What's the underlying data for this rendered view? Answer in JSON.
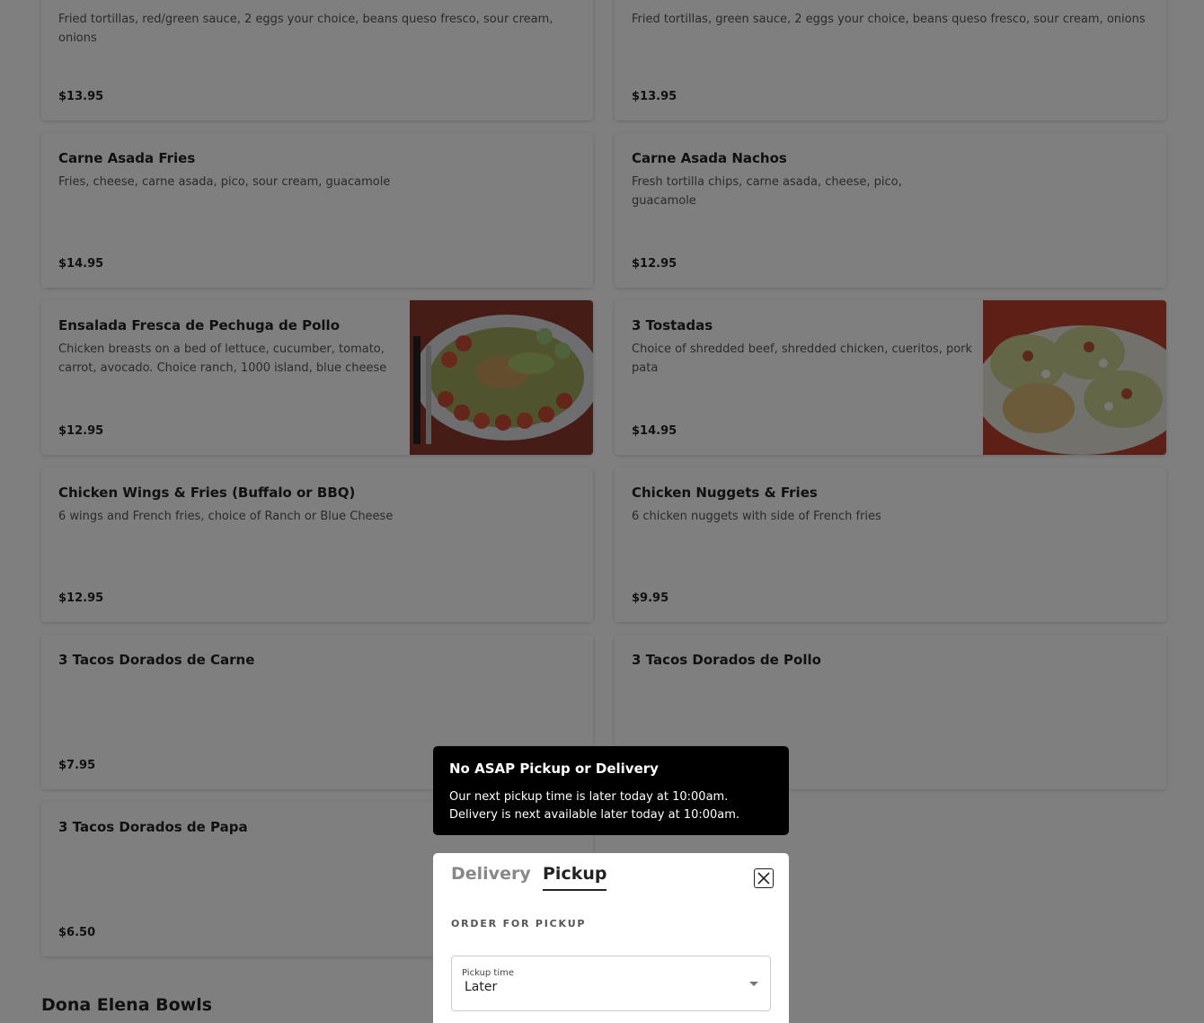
{
  "menu_items": [
    {
      "title": "",
      "description": "Fried tortillas, red/green sauce, 2 eggs your choice, beans queso fresco, sour cream, onions",
      "price": "$13.95"
    },
    {
      "title": "",
      "description": "Fried tortillas, green sauce, 2 eggs your choice, beans queso fresco, sour cream, onions",
      "price": "$13.95"
    },
    {
      "title": "Carne Asada Fries",
      "description": "Fries, cheese, carne asada, pico, sour cream, guacamole",
      "price": "$14.95"
    },
    {
      "title": "Carne Asada Nachos",
      "description": "Fresh tortilla chips, carne asada, cheese, pico, guacamole",
      "price": "$12.95"
    },
    {
      "title": "Ensalada Fresca de Pechuga de Pollo",
      "description": "Chicken breasts on a bed of lettuce, cucumber, tomato, carrot, avocado. Choice ranch, 1000 island, blue cheese",
      "price": "$12.95",
      "photo": "salad-photo"
    },
    {
      "title": "3 Tostadas",
      "description": "Choice of shredded beef, shredded chicken, cueritos, pork pata",
      "price": "$14.95",
      "photo": "tostadas-photo"
    },
    {
      "title": "Chicken Wings & Fries (Buffalo or BBQ)",
      "description": "6 wings and French fries, choice of Ranch or Blue Cheese",
      "price": "$12.95"
    },
    {
      "title": "Chicken Nuggets & Fries",
      "description": "6 chicken nuggets with side of French fries",
      "price": "$9.95"
    },
    {
      "title": "3 Tacos Dorados de Carne",
      "description": "",
      "price": "$7.95"
    },
    {
      "title": "3 Tacos Dorados de Pollo",
      "description": "",
      "price": ""
    },
    {
      "title": "3 Tacos Dorados de Papa",
      "description": "",
      "price": "$6.50"
    }
  ],
  "section": {
    "title": "Dona Elena Bowls"
  },
  "toast": {
    "title": "No ASAP Pickup or Delivery",
    "line1": "Our next pickup time is later today at 10:00am.",
    "line2": "Delivery is next available later today at 10:00am."
  },
  "modal": {
    "tabs": [
      {
        "label": "Delivery",
        "active": false
      },
      {
        "label": "Pickup",
        "active": true
      }
    ],
    "close_icon": "close-icon",
    "order_label": "ORDER FOR PICKUP",
    "pickup_time": {
      "label": "Pickup time",
      "value": "Later",
      "icon": "chevron-down-icon"
    }
  },
  "colors": {
    "overlay": "#000000",
    "toast_bg": "#000000",
    "text": "#222222",
    "muted": "#555555"
  }
}
